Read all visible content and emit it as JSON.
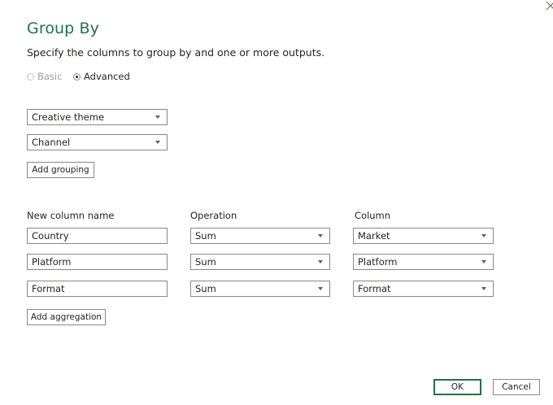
{
  "dialog": {
    "title": "Group By",
    "subtitle": "Specify the columns to group by and one or more outputs."
  },
  "mode": {
    "basic_label": "Basic",
    "advanced_label": "Advanced",
    "selected": "Advanced"
  },
  "grouping": {
    "fields": [
      "Creative theme",
      "Channel"
    ],
    "add_button": "Add grouping"
  },
  "aggregation": {
    "headers": {
      "name": "New column name",
      "operation": "Operation",
      "column": "Column"
    },
    "rows": [
      {
        "name": "Country",
        "operation": "Sum",
        "column": "Market"
      },
      {
        "name": "Platform",
        "operation": "Sum",
        "column": "Platform"
      },
      {
        "name": "Format",
        "operation": "Sum",
        "column": "Format"
      }
    ],
    "add_button": "Add aggregation"
  },
  "footer": {
    "ok_label": "OK",
    "cancel_label": "Cancel"
  },
  "colors": {
    "accent": "#217346",
    "border": "#8a8886"
  },
  "icons": {
    "close": "close-icon",
    "dropdown": "chevron-down-icon"
  }
}
